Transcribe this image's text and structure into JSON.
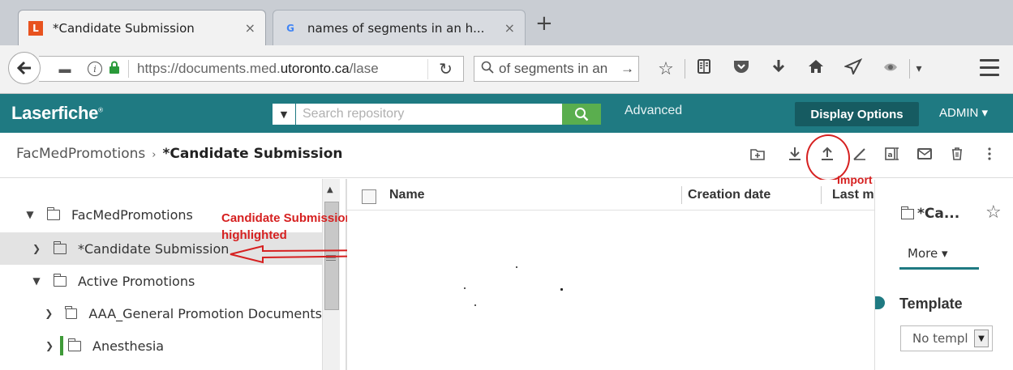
{
  "browser": {
    "tabs": [
      {
        "title": "*Candidate Submission",
        "favicon": "laserfiche-favicon",
        "favicon_text": "L",
        "active": true
      },
      {
        "title": "names of segments in an h...",
        "favicon": "google-favicon",
        "favicon_text": "G",
        "active": false
      }
    ],
    "close_glyph": "×",
    "url": {
      "prefix": "https://documents.med.",
      "domain": "utoronto.ca",
      "suffix": "/lase"
    },
    "search_text": "of segments in an",
    "toolbar_icons": [
      "bookmark-star-icon",
      "reader-view-icon",
      "pocket-icon",
      "downloads-icon",
      "home-icon",
      "send-tab-icon",
      "extension-icon",
      "overflow-icon",
      "hamburger-menu-icon"
    ]
  },
  "laserfiche": {
    "logo": "Laserfiche",
    "search_placeholder": "Search repository",
    "advanced_label": "Advanced",
    "display_options_label": "Display Options",
    "user_label": "ADMIN ▾",
    "accent_color": "#1f7a82"
  },
  "breadcrumb": {
    "root": "FacMedPromotions",
    "separator": "›",
    "current": "*Candidate Submission"
  },
  "toolbar": {
    "icons": [
      "new-folder-icon",
      "download-icon",
      "import-icon",
      "sign-icon",
      "text-recognition-icon",
      "email-icon",
      "delete-icon",
      "more-actions-icon"
    ]
  },
  "annotations": {
    "import_label": "Import",
    "folder_note_line1": "Candidate Submission folder",
    "folder_note_line2": "highlighted",
    "annotation_color": "#d62020"
  },
  "tree": {
    "items": [
      {
        "label": "FacMedPromotions",
        "expanded": true,
        "selected": false
      },
      {
        "label": "*Candidate Submission",
        "expanded": false,
        "selected": true
      },
      {
        "label": "Active Promotions",
        "expanded": true,
        "selected": false
      },
      {
        "label": "AAA_General Promotion Documents",
        "expanded": false,
        "selected": false
      },
      {
        "label": "Anesthesia",
        "expanded": false,
        "selected": false
      }
    ]
  },
  "file_list": {
    "columns": [
      "Name",
      "Creation date",
      "Last m"
    ]
  },
  "metadata_pane": {
    "entry_name": "*Ca...",
    "more_label": "More ▾",
    "template_heading": "Template",
    "template_value": "No templ"
  }
}
